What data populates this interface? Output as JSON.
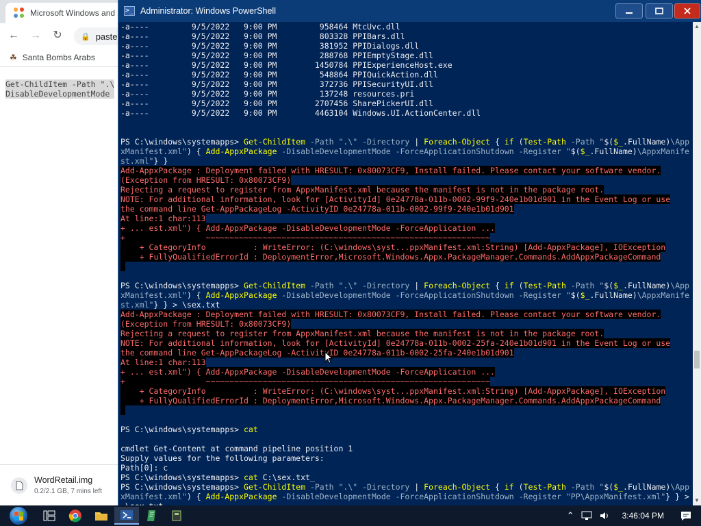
{
  "browser": {
    "tab_title": "Microsoft Windows and",
    "omnibox_text": "paste",
    "bookmark_label": "Santa Bombs Arabs",
    "page_code": [
      "Get-ChildItem -Path \".\\",
      "DisableDevelopmentMode "
    ],
    "download": {
      "name": "WordRetail.img",
      "status": "0.2/2.1 GB, 7 mins left"
    }
  },
  "powershell": {
    "title": "Administrator: Windows PowerShell",
    "lines": [
      {
        "type": "normal",
        "text": "-a----         9/5/2022   9:00 PM         958464 MtcUvc.dll"
      },
      {
        "type": "normal",
        "text": "-a----         9/5/2022   9:00 PM         803328 PPIBars.dll"
      },
      {
        "type": "normal",
        "text": "-a----         9/5/2022   9:00 PM         381952 PPIDialogs.dll"
      },
      {
        "type": "normal",
        "text": "-a----         9/5/2022   9:00 PM         288768 PPIEmptyStage.dll"
      },
      {
        "type": "normal",
        "text": "-a----         9/5/2022   9:00 PM        1450784 PPIExperienceHost.exe"
      },
      {
        "type": "normal",
        "text": "-a----         9/5/2022   9:00 PM         548864 PPIQuickAction.dll"
      },
      {
        "type": "normal",
        "text": "-a----         9/5/2022   9:00 PM         372736 PPISecurityUI.dll"
      },
      {
        "type": "normal",
        "text": "-a----         9/5/2022   9:00 PM         137248 resources.pri"
      },
      {
        "type": "normal",
        "text": "-a----         9/5/2022   9:00 PM        2707456 SharePickerUI.dll"
      },
      {
        "type": "normal",
        "text": "-a----         9/5/2022   9:00 PM        4463104 Windows.UI.ActionCenter.dll"
      },
      {
        "type": "normal",
        "text": ""
      },
      {
        "type": "normal",
        "text": ""
      },
      {
        "type": "cmd",
        "parts": [
          [
            "w",
            "PS C:\\windows\\systemapps> "
          ],
          [
            "y",
            "Get-ChildItem "
          ],
          [
            "g",
            "-Path "
          ],
          [
            "g",
            "\".\\\" "
          ],
          [
            "g",
            "-Directory "
          ],
          [
            "w",
            "| "
          ],
          [
            "y",
            "Foreach-Object "
          ],
          [
            "w",
            "{ "
          ],
          [
            "y",
            "if "
          ],
          [
            "w",
            "("
          ],
          [
            "y",
            "Test-Path "
          ],
          [
            "g",
            "-Path "
          ],
          [
            "g",
            "\""
          ],
          [
            "w",
            "$("
          ],
          [
            "y",
            "$_"
          ],
          [
            "w",
            ".FullName)"
          ],
          [
            "g",
            "\\App"
          ]
        ]
      },
      {
        "type": "cmd",
        "parts": [
          [
            "g",
            "xManifest.xml\""
          ],
          [
            "w",
            ") { "
          ],
          [
            "y",
            "Add-AppxPackage "
          ],
          [
            "g",
            "-DisableDevelopmentMode -ForceApplicationShutdown -Register "
          ],
          [
            "g",
            "\""
          ],
          [
            "w",
            "$("
          ],
          [
            "y",
            "$_"
          ],
          [
            "w",
            ".FullName)"
          ],
          [
            "g",
            "\\AppxManife"
          ]
        ]
      },
      {
        "type": "cmd",
        "parts": [
          [
            "g",
            "st.xml\""
          ],
          [
            "w",
            "} }"
          ]
        ]
      },
      {
        "type": "error",
        "text": "Add-AppxPackage : Deployment failed with HRESULT: 0x80073CF9, Install failed. Please contact your software vendor."
      },
      {
        "type": "error",
        "text": "(Exception from HRESULT: 0x80073CF9)"
      },
      {
        "type": "error",
        "text": "Rejecting a request to register from AppxManifest.xml because the manifest is not in the package root."
      },
      {
        "type": "error",
        "text": "NOTE: For additional information, look for [ActivityId] 0e24778a-011b-0002-99f9-240e1b01d901 in the Event Log or use"
      },
      {
        "type": "error",
        "text": "the command line Get-AppPackageLog -ActivityID 0e24778a-011b-0002-99f9-240e1b01d901"
      },
      {
        "type": "error",
        "text": "At line:1 char:113"
      },
      {
        "type": "error",
        "text": "+ ... est.xml\") { Add-AppxPackage -DisableDevelopmentMode -ForceApplication ..."
      },
      {
        "type": "error",
        "text": "+                 ~~~~~~~~~~~~~~~~~~~~~~~~~~~~~~~~~~~~~~~~~~~~~~~~~~~~~~~~~~~~"
      },
      {
        "type": "error",
        "text": "    + CategoryInfo          : WriteError: (C:\\windows\\syst...ppxManifest.xml:String) [Add-AppxPackage], IOException"
      },
      {
        "type": "error",
        "text": "    + FullyQualifiedErrorId : DeploymentError,Microsoft.Windows.Appx.PackageManager.Commands.AddAppxPackageCommand"
      },
      {
        "type": "error",
        "text": " "
      },
      {
        "type": "normal",
        "text": ""
      },
      {
        "type": "cmd",
        "parts": [
          [
            "w",
            "PS C:\\windows\\systemapps> "
          ],
          [
            "y",
            "Get-ChildItem "
          ],
          [
            "g",
            "-Path "
          ],
          [
            "g",
            "\".\\\" "
          ],
          [
            "g",
            "-Directory "
          ],
          [
            "w",
            "| "
          ],
          [
            "y",
            "Foreach-Object "
          ],
          [
            "w",
            "{ "
          ],
          [
            "y",
            "if "
          ],
          [
            "w",
            "("
          ],
          [
            "y",
            "Test-Path "
          ],
          [
            "g",
            "-Path "
          ],
          [
            "g",
            "\""
          ],
          [
            "w",
            "$("
          ],
          [
            "y",
            "$_"
          ],
          [
            "w",
            ".FullName)"
          ],
          [
            "g",
            "\\App"
          ]
        ]
      },
      {
        "type": "cmd",
        "parts": [
          [
            "g",
            "xManifest.xml\""
          ],
          [
            "w",
            ") { "
          ],
          [
            "y",
            "Add-AppxPackage "
          ],
          [
            "g",
            "-DisableDevelopmentMode -ForceApplicationShutdown -Register "
          ],
          [
            "g",
            "\""
          ],
          [
            "w",
            "$("
          ],
          [
            "y",
            "$_"
          ],
          [
            "w",
            ".FullName)"
          ],
          [
            "g",
            "\\AppxManife"
          ]
        ]
      },
      {
        "type": "cmd",
        "parts": [
          [
            "g",
            "st.xml\""
          ],
          [
            "w",
            "} } > \\sex.txt"
          ]
        ]
      },
      {
        "type": "error",
        "text": "Add-AppxPackage : Deployment failed with HRESULT: 0x80073CF9, Install failed. Please contact your software vendor."
      },
      {
        "type": "error",
        "text": "(Exception from HRESULT: 0x80073CF9)"
      },
      {
        "type": "error",
        "text": "Rejecting a request to register from AppxManifest.xml because the manifest is not in the package root."
      },
      {
        "type": "error",
        "text": "NOTE: For additional information, look for [ActivityId] 0e24778a-011b-0002-25fa-240e1b01d901 in the Event Log or use"
      },
      {
        "type": "error",
        "text": "the command line Get-AppPackageLog -ActivityID 0e24778a-011b-0002-25fa-240e1b01d901"
      },
      {
        "type": "error",
        "text": "At line:1 char:113"
      },
      {
        "type": "error",
        "text": "+ ... est.xml\") { Add-AppxPackage -DisableDevelopmentMode -ForceApplication ..."
      },
      {
        "type": "error",
        "text": "+                 ~~~~~~~~~~~~~~~~~~~~~~~~~~~~~~~~~~~~~~~~~~~~~~~~~~~~~~~~~~~~"
      },
      {
        "type": "error",
        "text": "    + CategoryInfo          : WriteError: (C:\\windows\\syst...ppxManifest.xml:String) [Add-AppxPackage], IOException"
      },
      {
        "type": "error",
        "text": "    + FullyQualifiedErrorId : DeploymentError,Microsoft.Windows.Appx.PackageManager.Commands.AddAppxPackageCommand"
      },
      {
        "type": "error",
        "text": " "
      },
      {
        "type": "normal",
        "text": ""
      },
      {
        "type": "cmd",
        "parts": [
          [
            "w",
            "PS C:\\windows\\systemapps> "
          ],
          [
            "y",
            "cat"
          ]
        ]
      },
      {
        "type": "normal",
        "text": ""
      },
      {
        "type": "normal",
        "text": "cmdlet Get-Content at command pipeline position 1"
      },
      {
        "type": "normal",
        "text": "Supply values for the following parameters:"
      },
      {
        "type": "normal",
        "text": "Path[0]: c"
      },
      {
        "type": "cmd",
        "parts": [
          [
            "w",
            "PS C:\\windows\\systemapps> "
          ],
          [
            "y",
            "cat "
          ],
          [
            "w",
            "C:\\sex.txt_"
          ]
        ]
      },
      {
        "type": "cmd",
        "parts": [
          [
            "w",
            "PS C:\\windows\\systemapps> "
          ],
          [
            "y",
            "Get-ChildItem "
          ],
          [
            "g",
            "-Path "
          ],
          [
            "g",
            "\".\\\" "
          ],
          [
            "g",
            "-Directory "
          ],
          [
            "w",
            "| "
          ],
          [
            "y",
            "Foreach-Object "
          ],
          [
            "w",
            "{ "
          ],
          [
            "y",
            "if "
          ],
          [
            "w",
            "("
          ],
          [
            "y",
            "Test-Path "
          ],
          [
            "g",
            "-Path "
          ],
          [
            "g",
            "\""
          ],
          [
            "w",
            "$("
          ],
          [
            "y",
            "$_"
          ],
          [
            "w",
            ".FullName)"
          ],
          [
            "g",
            "\\App"
          ]
        ]
      },
      {
        "type": "cmd",
        "parts": [
          [
            "g",
            "xManifest.xml\""
          ],
          [
            "w",
            ") { "
          ],
          [
            "y",
            "Add-AppxPackage "
          ],
          [
            "g",
            "-DisableDevelopmentMode -ForceApplicationShutdown -Register "
          ],
          [
            "g",
            "\"PP\\AppxManifest.xml\""
          ],
          [
            "w",
            "} } >"
          ]
        ]
      },
      {
        "type": "cmd",
        "parts": [
          [
            "w",
            " \\sex.txt"
          ]
        ]
      }
    ]
  },
  "taskbar": {
    "clock": "3:46:04 PM",
    "items": [
      "start",
      "task-view",
      "chrome",
      "file-explorer",
      "powershell",
      "app-green",
      "app-dark"
    ]
  }
}
